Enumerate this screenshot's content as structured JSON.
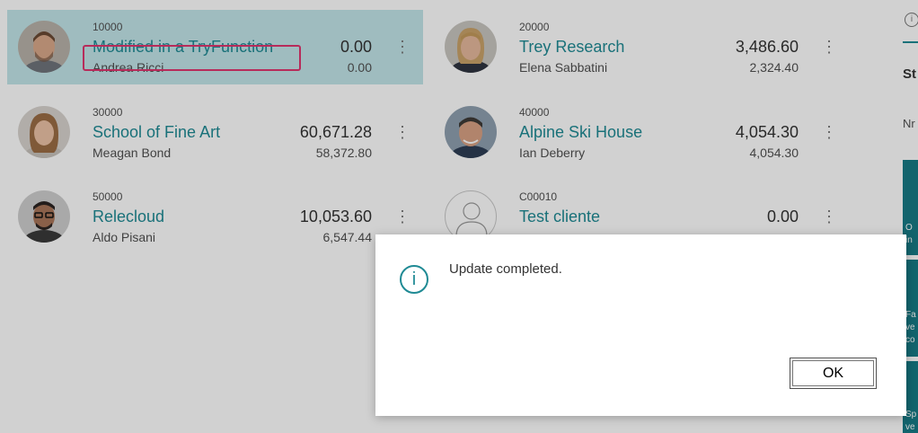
{
  "customers": [
    {
      "no": "10000",
      "name": "Modified in a TryFunction",
      "contact": "Andrea Ricci",
      "balance": "0.00",
      "balance_due": "0.00",
      "avatar": "photo-man-beard",
      "selected": true
    },
    {
      "no": "20000",
      "name": "Trey Research",
      "contact": "Elena Sabbatini",
      "balance": "3,486.60",
      "balance_due": "2,324.40",
      "avatar": "photo-woman-blonde"
    },
    {
      "no": "30000",
      "name": "School of Fine Art",
      "contact": "Meagan Bond",
      "balance": "60,671.28",
      "balance_due": "58,372.80",
      "avatar": "photo-woman-brown"
    },
    {
      "no": "40000",
      "name": "Alpine Ski House",
      "contact": "Ian Deberry",
      "balance": "4,054.30",
      "balance_due": "4,054.30",
      "avatar": "photo-man-older"
    },
    {
      "no": "50000",
      "name": "Relecloud",
      "contact": "Aldo Pisani",
      "balance": "10,053.60",
      "balance_due": "6,547.44",
      "avatar": "photo-man-glasses"
    },
    {
      "no": "C00010",
      "name": "Test cliente",
      "contact": "",
      "balance": "0.00",
      "balance_due": "",
      "avatar": "person-placeholder-icon"
    }
  ],
  "menu_glyph": "⋮",
  "factbox": {
    "info_glyph": "i",
    "heading_partial": "St",
    "label_partial": "Nr",
    "tiles": [
      {
        "text": [
          "O",
          "in"
        ]
      },
      {
        "text": [
          "Fa",
          "ve",
          "co"
        ]
      },
      {
        "text": [
          "Sp",
          "ve"
        ]
      }
    ]
  },
  "dialog": {
    "message": "Update completed.",
    "ok_label": "OK",
    "icon_glyph": "i"
  },
  "colors": {
    "accent": "#1f8a94",
    "selected_card": "#c3e6ea",
    "highlight_border": "#e0356e",
    "tile": "#167b85"
  }
}
